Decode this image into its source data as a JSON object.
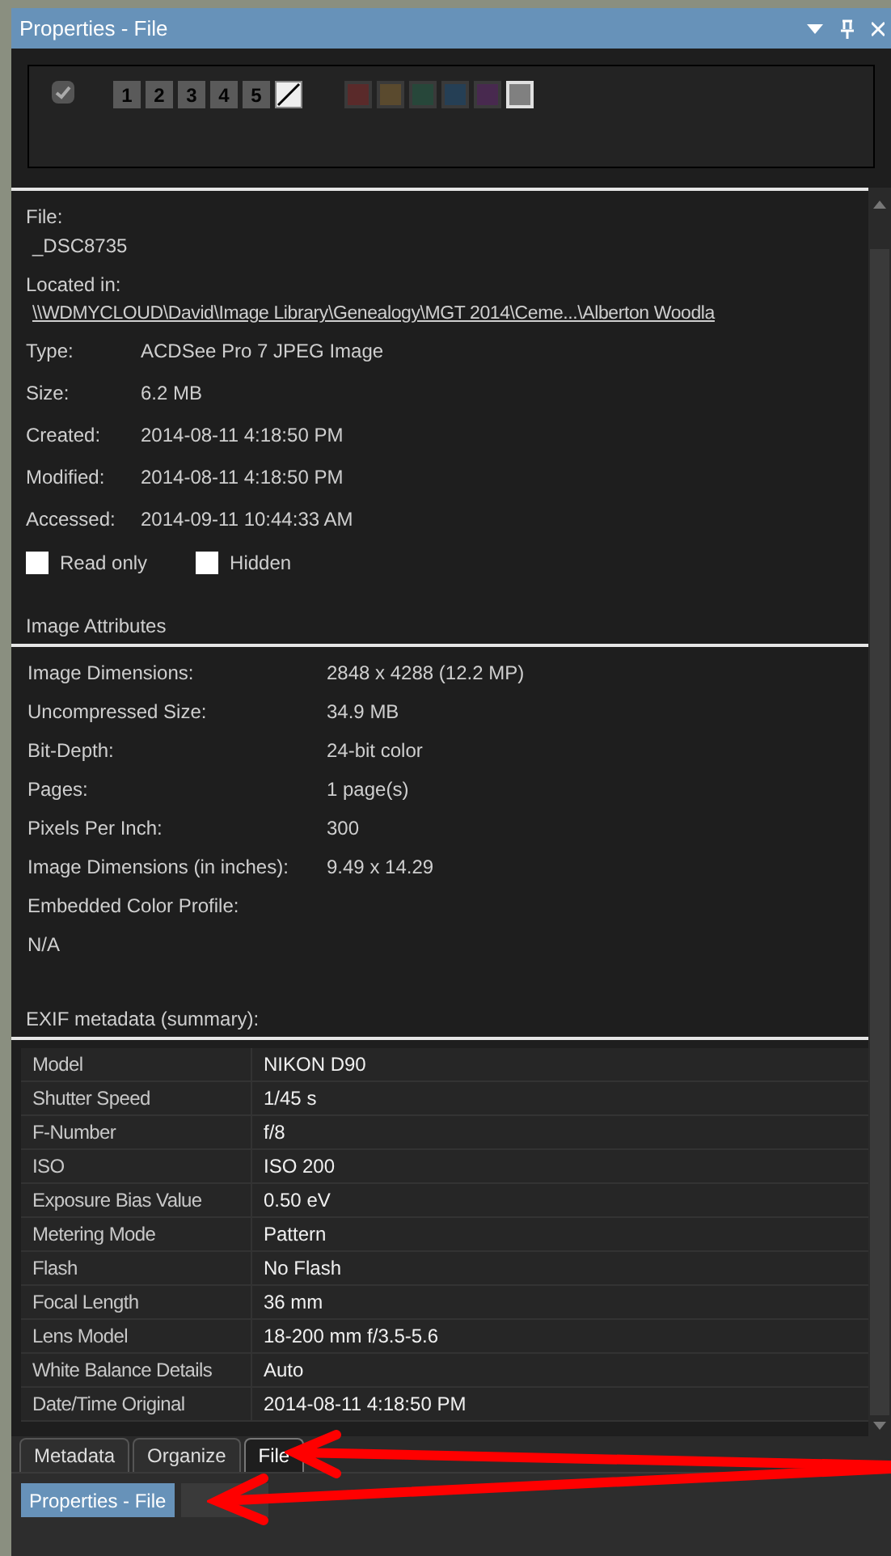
{
  "window": {
    "title": "Properties - File"
  },
  "label_checkbox": {
    "checked": true
  },
  "ratings": [
    {
      "label": "1",
      "selected": false
    },
    {
      "label": "2",
      "selected": false
    },
    {
      "label": "3",
      "selected": false
    },
    {
      "label": "4",
      "selected": false
    },
    {
      "label": "5",
      "selected": false
    }
  ],
  "clear_rating": {
    "selected": true
  },
  "color_labels": [
    {
      "color": "#5a2a2a",
      "selected": false
    },
    {
      "color": "#5a4a2e",
      "selected": false
    },
    {
      "color": "#27473a",
      "selected": false
    },
    {
      "color": "#253f55",
      "selected": false
    },
    {
      "color": "#48294f",
      "selected": false
    },
    {
      "color": "#808080",
      "selected": true
    }
  ],
  "file": {
    "file_label": "File:",
    "file_name": "_DSC8735",
    "location_label": "Located in:",
    "location": "\\\\WDMYCLOUD\\David\\Image Library\\Genealogy\\MGT 2014\\Ceme...\\Alberton Woodla",
    "fields": [
      {
        "label": "Type:",
        "value": "ACDSee Pro 7 JPEG Image"
      },
      {
        "label": "Size:",
        "value": "6.2 MB"
      },
      {
        "label": "Created:",
        "value": "2014-08-11 4:18:50 PM"
      },
      {
        "label": "Modified:",
        "value": "2014-08-11 4:18:50 PM"
      },
      {
        "label": "Accessed:",
        "value": "2014-09-11 10:44:33 AM"
      }
    ],
    "attributes": [
      {
        "label": "Read only",
        "checked": false
      },
      {
        "label": "Hidden",
        "checked": false
      }
    ]
  },
  "image_attributes": {
    "title": "Image Attributes",
    "fields": [
      {
        "label": "Image Dimensions:",
        "value": "2848 x 4288 (12.2 MP)"
      },
      {
        "label": "Uncompressed Size:",
        "value": "34.9 MB"
      },
      {
        "label": "Bit-Depth:",
        "value": "24-bit color"
      },
      {
        "label": "Pages:",
        "value": "1 page(s)"
      },
      {
        "label": "Pixels Per Inch:",
        "value": "300"
      },
      {
        "label": "Image Dimensions (in inches):",
        "value": "9.49 x 14.29"
      },
      {
        "label": "Embedded Color Profile:"
      }
    ],
    "color_profile": "N/A"
  },
  "exif": {
    "title": "EXIF metadata (summary):",
    "rows": [
      {
        "label": "Model",
        "value": "NIKON D90"
      },
      {
        "label": "Shutter Speed",
        "value": "1/45 s"
      },
      {
        "label": "F-Number",
        "value": "f/8"
      },
      {
        "label": "ISO",
        "value": "ISO 200"
      },
      {
        "label": "Exposure Bias Value",
        "value": "0.50 eV"
      },
      {
        "label": "Metering Mode",
        "value": "Pattern"
      },
      {
        "label": "Flash",
        "value": "No Flash"
      },
      {
        "label": "Focal Length",
        "value": "36 mm"
      },
      {
        "label": "Lens Model",
        "value": "18-200 mm f/3.5-5.6"
      },
      {
        "label": "White Balance Details",
        "value": "Auto"
      },
      {
        "label": "Date/Time Original",
        "value": "2014-08-11 4:18:50 PM"
      }
    ]
  },
  "tabs": [
    {
      "label": "Metadata",
      "selected": false
    },
    {
      "label": "Organize",
      "selected": false
    },
    {
      "label": "File",
      "selected": true
    }
  ],
  "pane_tabs": [
    {
      "label": "Properties - File",
      "selected": true
    },
    {
      "selected": false
    }
  ]
}
